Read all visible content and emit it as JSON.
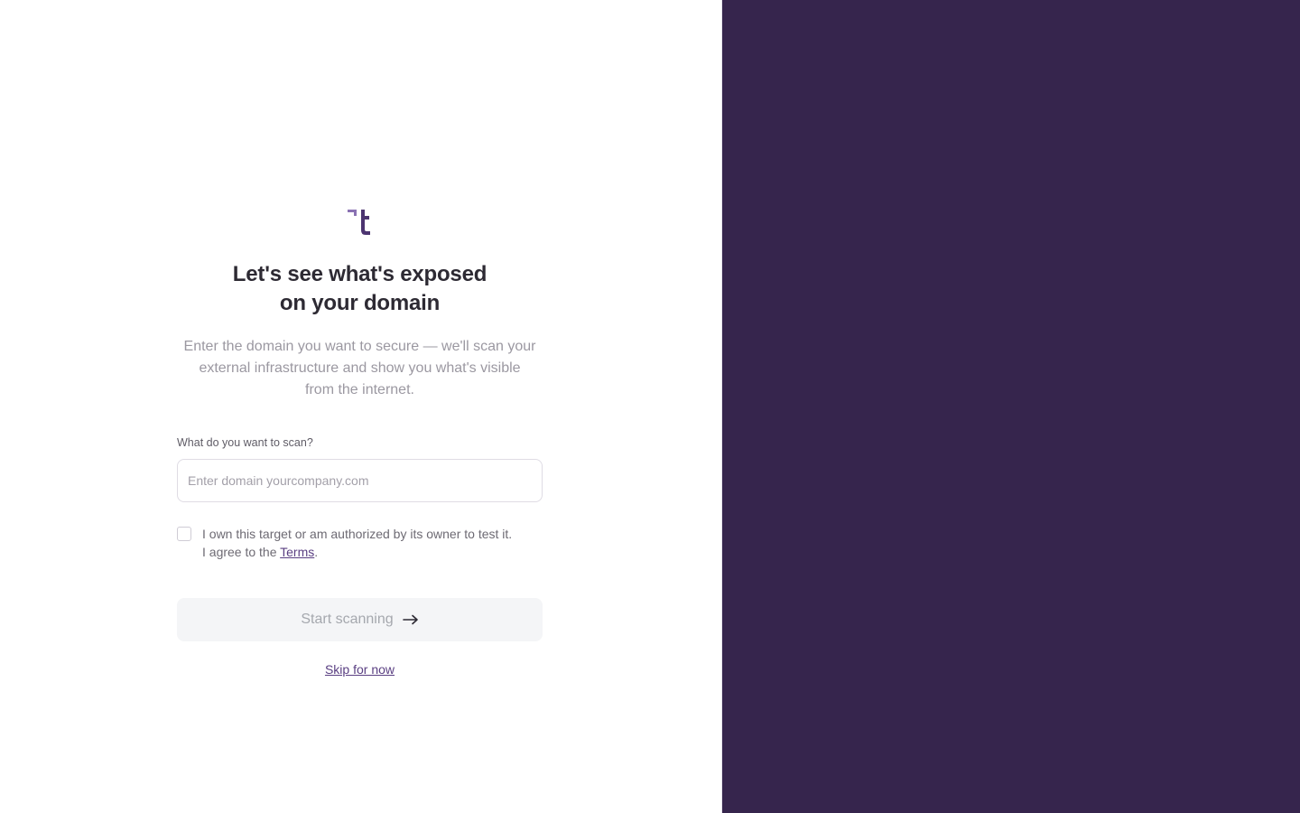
{
  "brand": {
    "logo_icon": "brand-logo-icon",
    "accent_color": "#5a3f82",
    "panel_color": "#36254d"
  },
  "heading": {
    "line1": "Let's see what's exposed",
    "line2": "on your domain"
  },
  "subtitle": {
    "line1": "Enter the domain you want to secure — we'll scan your",
    "line2": "external infrastructure and show you what's visible",
    "line3": "from the internet."
  },
  "domain_field": {
    "label": "What do you want to scan?",
    "placeholder": "Enter domain yourcompany.com",
    "value": ""
  },
  "consent": {
    "checked": false,
    "line1": "I own this target or am authorized by its owner to test it.",
    "line2_prefix": "I agree to the ",
    "terms_label": "Terms",
    "line2_suffix": "."
  },
  "start_button": {
    "label": "Start scanning",
    "icon": "arrow-right-icon",
    "disabled": true
  },
  "skip_link": {
    "label": "Skip for now"
  }
}
